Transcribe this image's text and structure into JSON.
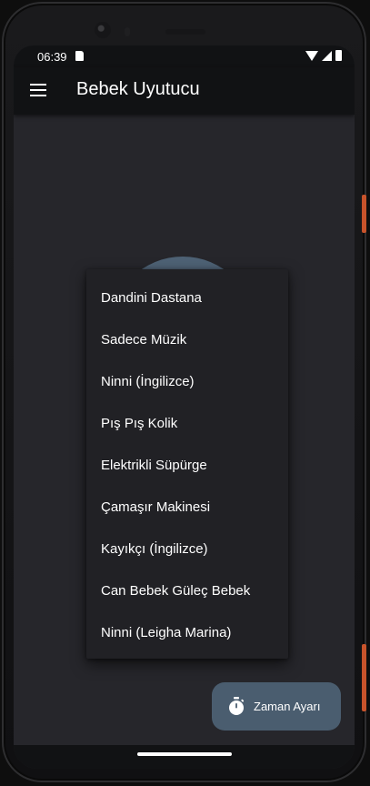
{
  "status_bar": {
    "time": "06:39"
  },
  "app_bar": {
    "title": "Bebek Uyutucu"
  },
  "dropdown": {
    "items": [
      {
        "label": "Dandini Dastana"
      },
      {
        "label": "Sadece Müzik"
      },
      {
        "label": "Ninni (İngilizce)"
      },
      {
        "label": "Pış Pış Kolik"
      },
      {
        "label": "Elektrikli Süpürge"
      },
      {
        "label": "Çamaşır Makinesi"
      },
      {
        "label": "Kayıkçı (İngilizce)"
      },
      {
        "label": "Can Bebek Güleç Bebek"
      },
      {
        "label": "Ninni (Leigha Marina)"
      }
    ]
  },
  "fab": {
    "label": "Zaman Ayarı",
    "icon": "timer-icon"
  },
  "colors": {
    "screen_bg": "#26262b",
    "bar_bg": "#111214",
    "accent": "#4a5d6f",
    "menu_bg": "#212125"
  }
}
